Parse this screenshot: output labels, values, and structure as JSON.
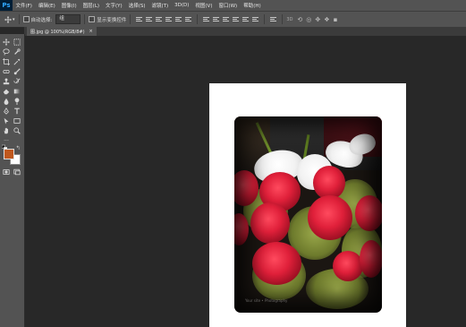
{
  "app": {
    "logo": "Ps"
  },
  "menu": [
    "文件(F)",
    "编辑(E)",
    "图像(I)",
    "图层(L)",
    "文字(Y)",
    "选择(S)",
    "滤镜(T)",
    "3D(D)",
    "视图(V)",
    "窗口(W)",
    "帮助(H)"
  ],
  "options": {
    "auto_select_label": "自动选择:",
    "auto_select_value": "组",
    "show_transform_label": "显示变换控件"
  },
  "document_tab": {
    "title": "图.jpg @ 100%(RGB/8#)",
    "close": "×"
  },
  "photo": {
    "watermark": "Your site • Photography"
  },
  "colors": {
    "foreground": "#c0581e",
    "background": "#ffffff"
  }
}
